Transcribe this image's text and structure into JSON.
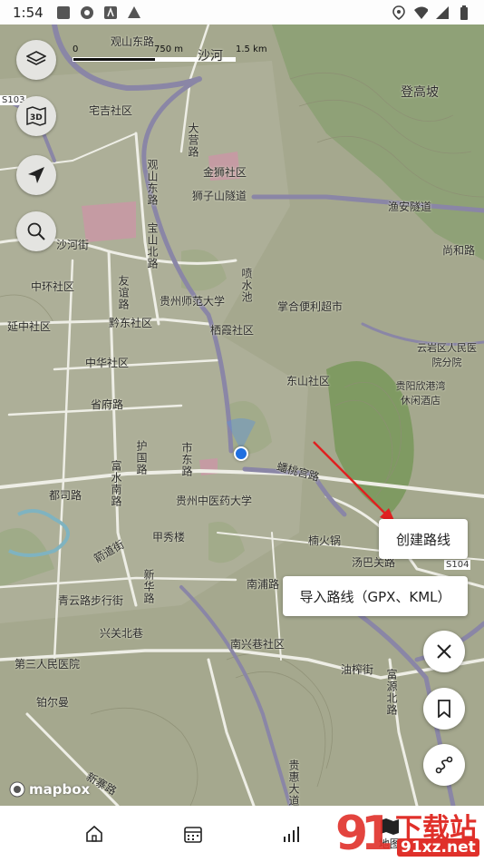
{
  "status_bar": {
    "time": "1:54"
  },
  "scale": {
    "zero": "0",
    "mid": "750 m",
    "max": "1.5 km"
  },
  "map_labels": {
    "l1": "观山东路",
    "l2": "沙河",
    "l3": "宅吉社区",
    "l4": "大营路",
    "l5": "金狮社区",
    "l6": "观山东路",
    "l7": "狮子山隧道",
    "l8": "登高坡",
    "l9": "渔安隧道",
    "l10": "宝山北路",
    "l11": "沙河街",
    "l12": "尚和路",
    "l13": "中环社区",
    "l14": "友谊路",
    "l15": "贵州师范大学",
    "l16": "喷水池",
    "l17": "掌合便利超市",
    "l18": "黔东社区",
    "l19": "栖霞社区",
    "l20": "云岩区人民医院分院",
    "l21": "延中社区",
    "l22": "中华社区",
    "l23": "东山社区",
    "l24": "省府路",
    "l25": "贵阳欣港湾休闲酒店",
    "l26": "护国路",
    "l27": "富水南路",
    "l28": "市东路",
    "l29": "蟠桃宫路",
    "l30": "都司路",
    "l31": "贵州中医药大学",
    "l32": "甲秀楼",
    "l33": "楠火锅",
    "l34": "箭道街",
    "l35": "汤巴关路",
    "l36": "新华路",
    "l37": "南浦路",
    "l38": "青云路步行街",
    "l39": "兴关北巷",
    "l40": "南兴巷社区",
    "l41": "第三人民医院",
    "l42": "油榨街",
    "l43": "铂尔曼",
    "l44": "富源北路",
    "l45": "新寨路",
    "l46": "贵惠大道",
    "l47": "S103",
    "l48": "S104"
  },
  "menu": {
    "create_route": "创建路线",
    "import_route": "导入路线（GPX、KML）"
  },
  "brand": {
    "mapbox": "mapbox"
  },
  "nav": {
    "map_label": "地图"
  },
  "watermark": {
    "text": "下载站",
    "url": "91xz.net"
  },
  "colors": {
    "accent": "#1f6fe0",
    "arrow": "#e02020",
    "map_bg": "#a5a88e"
  }
}
